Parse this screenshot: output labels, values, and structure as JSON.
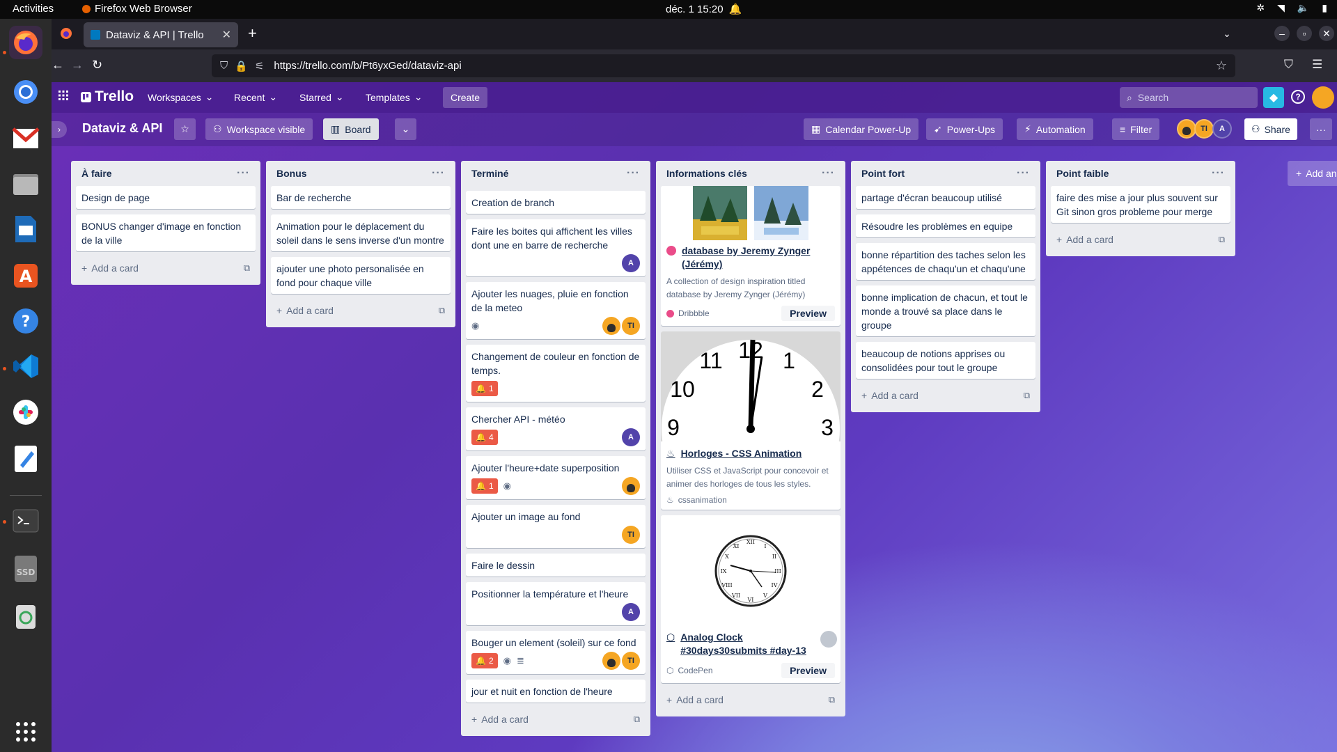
{
  "topbar": {
    "activities": "Activities",
    "app_name": "Firefox Web Browser",
    "datetime": "déc. 1  15:20"
  },
  "browser": {
    "tab_title": "Dataviz & API | Trello",
    "url": "https://trello.com/b/Pt6yxGed/dataviz-api"
  },
  "trello": {
    "logo": "Trello",
    "menus": [
      "Workspaces",
      "Recent",
      "Starred",
      "Templates"
    ],
    "create": "Create",
    "search_placeholder": "Search"
  },
  "board": {
    "title": "Dataviz & API",
    "visibility": "Workspace visible",
    "view": "Board",
    "calendar": "Calendar Power-Up",
    "powerups": "Power-Ups",
    "automation": "Automation",
    "filter": "Filter",
    "share": "Share",
    "add_list": "Add another list",
    "add_card": "Add a card"
  },
  "lists": [
    {
      "title": "À faire",
      "cards": [
        "Design de page",
        "BONUS changer d'image en fonction de la ville"
      ]
    },
    {
      "title": "Bonus",
      "cards": [
        "Bar de recherche",
        "Animation pour le déplacement du soleil dans le sens inverse d'un montre",
        "ajouter une photo personalisée en fond pour chaque ville"
      ]
    },
    {
      "title": "Terminé",
      "cards": [
        "Creation de branch",
        "Faire les boites qui affichent les villes dont une en barre de recherche",
        "Ajouter les nuages, pluie en fonction de la meteo",
        "Changement de couleur en fonction de temps.",
        "Chercher API - météo",
        "Ajouter l'heure+date superposition",
        "Ajouter un image au fond",
        "Faire le dessin",
        "Positionner la température et l'heure",
        "Bouger un element (soleil) sur ce fond",
        "jour et nuit en fonction de l'heure"
      ],
      "badges": {
        "changement": "1",
        "chercher": "4",
        "heure_date": "1",
        "bouger": "2"
      }
    },
    {
      "title": "Informations clés",
      "links": [
        {
          "title": "database by Jeremy Zynger (Jérémy)",
          "desc": "A collection of design inspiration titled database by Jeremy Zynger (Jérémy)",
          "source": "Dribbble",
          "preview": "Preview"
        },
        {
          "title": "Horloges - CSS Animation",
          "desc": "Utiliser CSS et JavaScript pour concevoir et animer des horloges de tous les styles.",
          "source": "cssanimation"
        },
        {
          "title": "Analog Clock #30days30submits #day-13",
          "source": "CodePen",
          "preview": "Preview"
        }
      ]
    },
    {
      "title": "Point fort",
      "cards": [
        "partage d'écran beaucoup utilisé",
        "Résoudre les problèmes en equipe",
        "bonne répartition des taches selon les appétences de chaqu'un et chaqu'une",
        "bonne implication de chacun, et tout le monde a trouvé sa place dans le groupe",
        "beaucoup de notions apprises ou consolidées pour tout le groupe"
      ]
    },
    {
      "title": "Point faible",
      "cards": [
        "faire des mise a jour plus souvent sur Git sinon gros probleme pour merge"
      ]
    }
  ],
  "avatars": {
    "a": "A",
    "ti": "TI"
  },
  "clock_numbers": [
    "12",
    "1",
    "2",
    "3",
    "9",
    "10",
    "11"
  ],
  "colors": {
    "trello_purple": "#5b2fa8",
    "list_bg": "#ebecf0",
    "badge_red": "#eb5a46",
    "member_a": "#5243aa",
    "member_ti": "#f5a623"
  }
}
